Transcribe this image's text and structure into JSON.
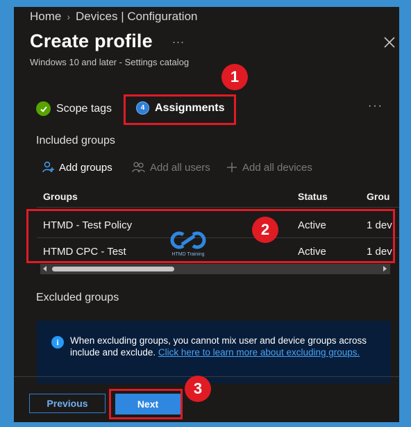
{
  "breadcrumb": {
    "home": "Home",
    "devices": "Devices | Configuration"
  },
  "header": {
    "title": "Create profile",
    "more": "···",
    "subtitle": "Windows 10 and later - Settings catalog"
  },
  "tabs": [
    {
      "label": "Scope tags",
      "state": "complete",
      "icon": "check-circle-icon"
    },
    {
      "label": "Assignments",
      "state": "current",
      "number": "4"
    }
  ],
  "tabs_more": "···",
  "included": {
    "title": "Included groups",
    "toolbar": [
      {
        "label": "Add groups",
        "icon": "add-user-icon",
        "enabled": true
      },
      {
        "label": "Add all users",
        "icon": "users-icon",
        "enabled": false
      },
      {
        "label": "Add all devices",
        "icon": "plus-icon",
        "enabled": false
      }
    ],
    "columns": [
      "Groups",
      "Status",
      "Grou"
    ],
    "rows": [
      {
        "group": "HTMD - Test Policy",
        "status": "Active",
        "count": "1 dev"
      },
      {
        "group": "HTMD CPC - Test",
        "status": "Active",
        "count": "1 dev"
      }
    ]
  },
  "excluded": {
    "title": "Excluded groups",
    "info_text": "When excluding groups, you cannot mix user and device groups across include and exclude.",
    "info_link": "Click here to learn more about excluding groups."
  },
  "footer": {
    "previous": "Previous",
    "next": "Next"
  },
  "callouts": [
    "1",
    "2",
    "3"
  ],
  "watermark": "HTMD Training",
  "colors": {
    "accent": "#2f87e0",
    "callout": "#e01b24",
    "success": "#57a300",
    "panel": "#1b1a19"
  }
}
